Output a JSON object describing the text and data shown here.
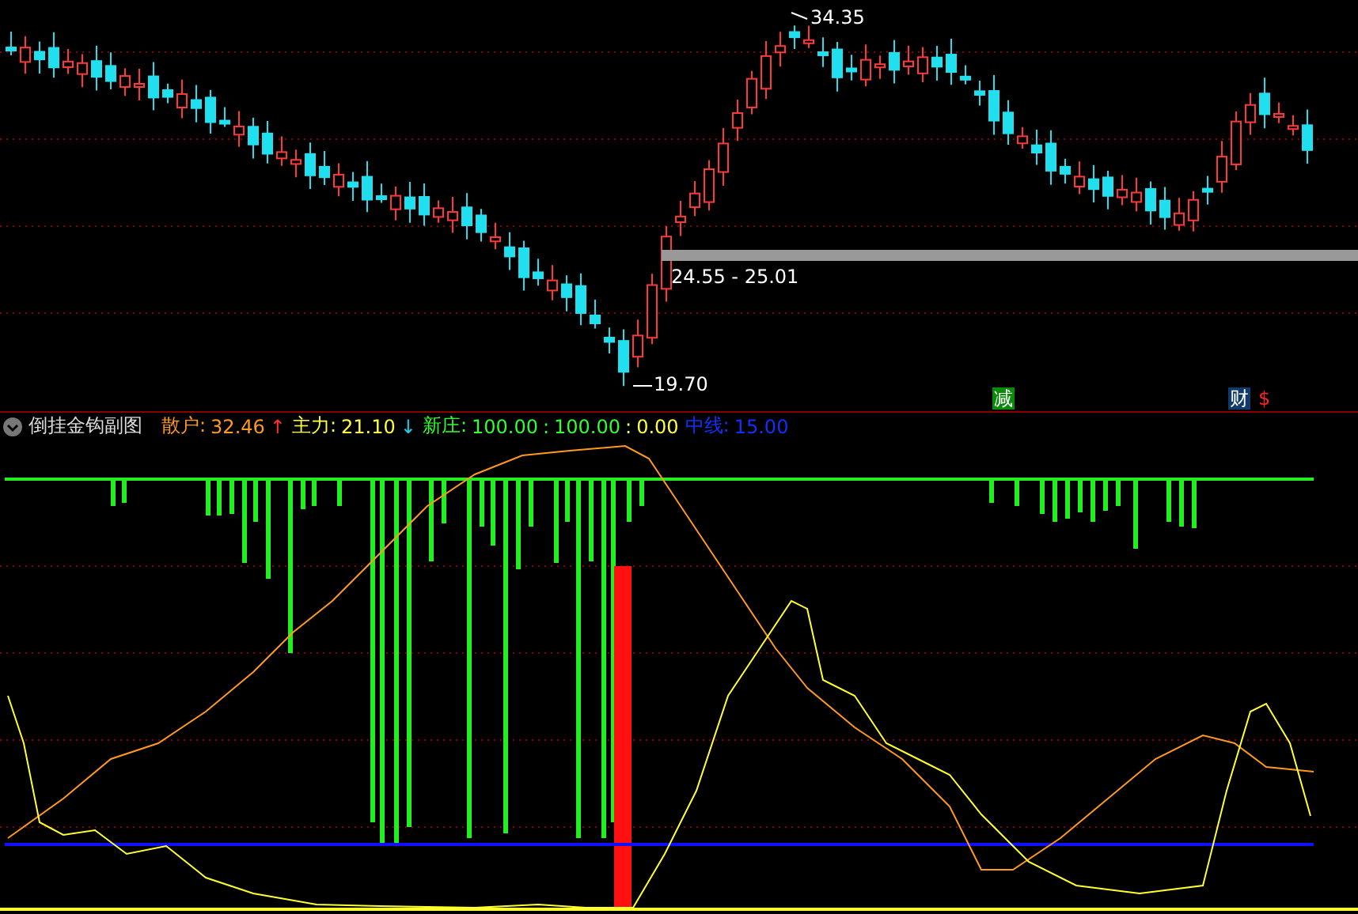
{
  "main_chart": {
    "high_label": "34.35",
    "range_label": "24.55 - 25.01",
    "low_label": "19.70",
    "markers": [
      {
        "text": "减",
        "kind": "reduce"
      },
      {
        "text": "财",
        "kind": "finance"
      },
      {
        "text": "$",
        "kind": "dollar"
      }
    ]
  },
  "indicator": {
    "title": "倒挂金钩副图",
    "items": [
      {
        "label": "散户:",
        "color": "#ff9a1f",
        "parts": [
          {
            "text": "32.46",
            "color": "#ff9a1f"
          },
          {
            "text": "↑",
            "color": "#ff3030"
          }
        ]
      },
      {
        "label": "主力:",
        "color": "#ffff40",
        "parts": [
          {
            "text": "21.10",
            "color": "#ffff40"
          },
          {
            "text": "↓",
            "color": "#20d0f0"
          }
        ]
      },
      {
        "label": "新庄:",
        "color": "#30ff30",
        "parts": [
          {
            "text": "100.00",
            "color": "#30ff30"
          },
          {
            "text": ":",
            "color": "#30ff30"
          },
          {
            "text": "100.00",
            "color": "#30ff30"
          },
          {
            "text": ":",
            "color": "#ffff40"
          },
          {
            "text": "0.00",
            "color": "#ffff40"
          }
        ]
      },
      {
        "label": "中线:",
        "color": "#1030ff",
        "parts": [
          {
            "text": "15.00",
            "color": "#1030ff"
          }
        ]
      }
    ]
  }
}
